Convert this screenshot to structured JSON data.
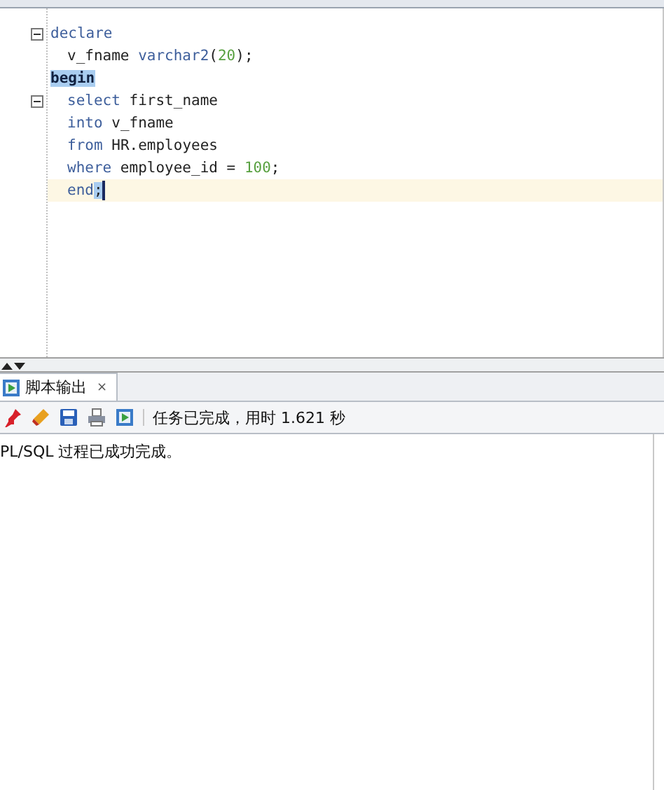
{
  "editor": {
    "lines": [
      {
        "fold": true,
        "current": false,
        "indent": false,
        "tokens": [
          {
            "text": "declare",
            "kind": "keyword",
            "highlight": false
          }
        ]
      },
      {
        "fold": false,
        "current": false,
        "indent": true,
        "tokens": [
          {
            "text": "v_fname ",
            "kind": "plain",
            "highlight": false
          },
          {
            "text": "varchar2",
            "kind": "keyword",
            "highlight": false
          },
          {
            "text": "(",
            "kind": "plain",
            "highlight": false
          },
          {
            "text": "20",
            "kind": "number",
            "highlight": false
          },
          {
            "text": ");",
            "kind": "plain",
            "highlight": false
          }
        ]
      },
      {
        "fold": false,
        "current": false,
        "indent": false,
        "tokens": [
          {
            "text": "begin",
            "kind": "bold",
            "highlight": true
          }
        ]
      },
      {
        "fold": true,
        "current": false,
        "indent": true,
        "tokens": [
          {
            "text": "select",
            "kind": "keyword",
            "highlight": false
          },
          {
            "text": " first_name",
            "kind": "plain",
            "highlight": false
          }
        ]
      },
      {
        "fold": false,
        "current": false,
        "indent": true,
        "tokens": [
          {
            "text": "into",
            "kind": "keyword",
            "highlight": false
          },
          {
            "text": " v_fname",
            "kind": "plain",
            "highlight": false
          }
        ]
      },
      {
        "fold": false,
        "current": false,
        "indent": true,
        "tokens": [
          {
            "text": "from",
            "kind": "keyword",
            "highlight": false
          },
          {
            "text": " HR.employees",
            "kind": "plain",
            "highlight": false
          }
        ]
      },
      {
        "fold": false,
        "current": false,
        "indent": true,
        "tokens": [
          {
            "text": "where",
            "kind": "keyword",
            "highlight": false
          },
          {
            "text": " employee_id = ",
            "kind": "plain",
            "highlight": false
          },
          {
            "text": "100",
            "kind": "number",
            "highlight": false
          },
          {
            "text": ";",
            "kind": "plain",
            "highlight": false
          }
        ]
      },
      {
        "fold": false,
        "current": true,
        "indent": true,
        "tokens": [
          {
            "text": "end",
            "kind": "keyword",
            "highlight": false
          },
          {
            "text": ";",
            "kind": "plain",
            "highlight": true
          }
        ]
      }
    ]
  },
  "output_panel": {
    "tabs": [
      {
        "label": "脚本输出",
        "close": "×",
        "selected": true
      }
    ],
    "status": "任务已完成，用时 1.621 秒",
    "output": "PL/SQL 过程已成功完成。"
  }
}
